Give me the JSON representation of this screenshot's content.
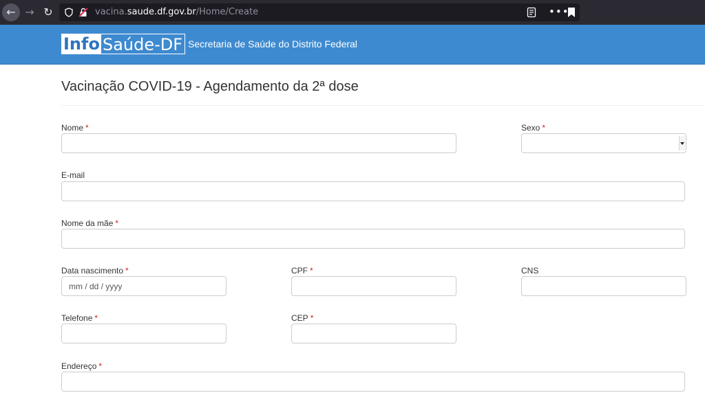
{
  "browser": {
    "url_host_prefix": "vacina.",
    "url_host_main": "saude.df.gov.br",
    "url_path": "/Home/Create",
    "more_label": "•••"
  },
  "header": {
    "logo_info": "Info",
    "logo_saude": "Saúde-DF",
    "subtitle": "Secretaria de Saúde do Distrito Federal",
    "background_color": "#3e8ad0"
  },
  "page": {
    "title": "Vacinação COVID-19 - Agendamento da 2ª dose"
  },
  "form": {
    "required_marker": "*",
    "nome": {
      "label": "Nome",
      "value": ""
    },
    "sexo": {
      "label": "Sexo",
      "value": ""
    },
    "email": {
      "label": "E-mail",
      "value": ""
    },
    "nome_mae": {
      "label": "Nome da mãe",
      "value": ""
    },
    "data_nascimento": {
      "label": "Data nascimento",
      "placeholder": "mm / dd / yyyy"
    },
    "cpf": {
      "label": "CPF",
      "value": ""
    },
    "cns": {
      "label": "CNS",
      "value": ""
    },
    "telefone": {
      "label": "Telefone",
      "value": ""
    },
    "cep": {
      "label": "CEP",
      "value": ""
    },
    "endereco": {
      "label": "Endereço",
      "value": ""
    }
  }
}
